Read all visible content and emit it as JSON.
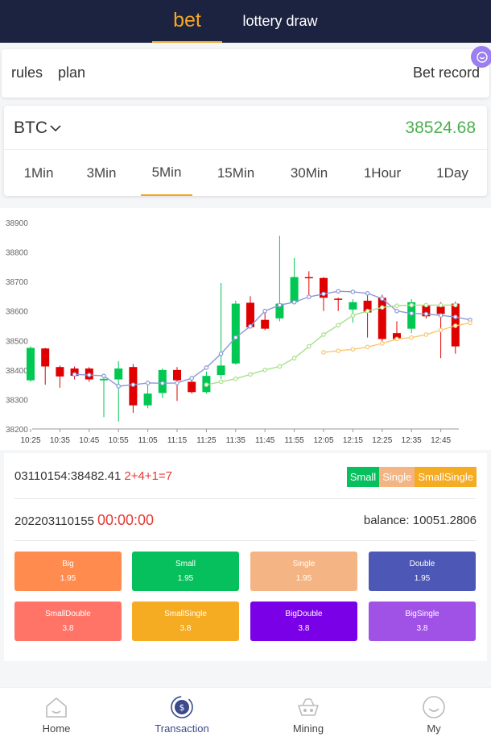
{
  "top_tabs": {
    "bet": "bet",
    "draw": "lottery draw"
  },
  "links": {
    "rules": "rules",
    "plan": "plan",
    "bet_record": "Bet record"
  },
  "market": {
    "symbol": "BTC",
    "price": "38524.68",
    "intervals": [
      "1Min",
      "3Min",
      "5Min",
      "15Min",
      "30Min",
      "1Hour",
      "1Day"
    ],
    "active_interval": "5Min"
  },
  "chart_data": {
    "type": "candlestick",
    "ylim": [
      38200,
      38900
    ],
    "yticks": [
      "38200",
      "38300",
      "38400",
      "38500",
      "38600",
      "38700",
      "38800",
      "38900"
    ],
    "xticks": [
      "10:25",
      "10:35",
      "10:45",
      "10:55",
      "11:05",
      "11:15",
      "11:25",
      "11:35",
      "11:45",
      "11:55",
      "12:05",
      "12:15",
      "12:25",
      "12:35",
      "12:45"
    ],
    "up_color": "#00c853",
    "down_color": "#e00000",
    "candles": [
      {
        "o": 38365,
        "c": 38475,
        "h": 38480,
        "l": 38360
      },
      {
        "o": 38473,
        "c": 38412,
        "h": 38475,
        "l": 38350
      },
      {
        "o": 38410,
        "c": 38378,
        "h": 38415,
        "l": 38340
      },
      {
        "o": 38405,
        "c": 38380,
        "h": 38412,
        "l": 38368
      },
      {
        "o": 38405,
        "c": 38368,
        "h": 38410,
        "l": 38360
      },
      {
        "o": 38365,
        "c": 38370,
        "h": 38380,
        "l": 38240
      },
      {
        "o": 38368,
        "c": 38405,
        "h": 38430,
        "l": 38225
      },
      {
        "o": 38410,
        "c": 38280,
        "h": 38420,
        "l": 38255
      },
      {
        "o": 38280,
        "c": 38320,
        "h": 38360,
        "l": 38270
      },
      {
        "o": 38322,
        "c": 38400,
        "h": 38405,
        "l": 38305
      },
      {
        "o": 38400,
        "c": 38365,
        "h": 38410,
        "l": 38295
      },
      {
        "o": 38360,
        "c": 38325,
        "h": 38375,
        "l": 38320
      },
      {
        "o": 38325,
        "c": 38380,
        "h": 38395,
        "l": 38320
      },
      {
        "o": 38383,
        "c": 38415,
        "h": 38695,
        "l": 38370
      },
      {
        "o": 38422,
        "c": 38625,
        "h": 38635,
        "l": 38418
      },
      {
        "o": 38628,
        "c": 38545,
        "h": 38650,
        "l": 38540
      },
      {
        "o": 38570,
        "c": 38540,
        "h": 38600,
        "l": 38535
      },
      {
        "o": 38575,
        "c": 38625,
        "h": 38855,
        "l": 38565
      },
      {
        "o": 38630,
        "c": 38715,
        "h": 38780,
        "l": 38625
      },
      {
        "o": 38715,
        "c": 38714,
        "h": 38735,
        "l": 38650
      },
      {
        "o": 38712,
        "c": 38645,
        "h": 38715,
        "l": 38600
      },
      {
        "o": 38642,
        "c": 38641,
        "h": 38645,
        "l": 38600
      },
      {
        "o": 38605,
        "c": 38630,
        "h": 38640,
        "l": 38560
      },
      {
        "o": 38635,
        "c": 38595,
        "h": 38665,
        "l": 38510
      },
      {
        "o": 38645,
        "c": 38505,
        "h": 38655,
        "l": 38495
      },
      {
        "o": 38525,
        "c": 38505,
        "h": 38565,
        "l": 38500
      },
      {
        "o": 38540,
        "c": 38630,
        "h": 38640,
        "l": 38525
      },
      {
        "o": 38618,
        "c": 38582,
        "h": 38625,
        "l": 38575
      },
      {
        "o": 38615,
        "c": 38590,
        "h": 38630,
        "l": 38440
      },
      {
        "o": 38625,
        "c": 38480,
        "h": 38632,
        "l": 38455
      }
    ],
    "ma_series": [
      {
        "color": "#8b98d8",
        "start": 3,
        "values": [
          38385,
          38383,
          38380,
          38345,
          38350,
          38356,
          38355,
          38356,
          38372,
          38408,
          38455,
          38510,
          38548,
          38600,
          38620,
          38630,
          38648,
          38658,
          38667,
          38665,
          38660,
          38642,
          38600,
          38592,
          38590,
          38585,
          38580,
          38570
        ]
      },
      {
        "color": "#a8e08a",
        "start": 12,
        "values": [
          38350,
          38360,
          38370,
          38385,
          38400,
          38412,
          38440,
          38480,
          38520,
          38552,
          38585,
          38600,
          38612,
          38618,
          38620,
          38620,
          38620,
          38620
        ]
      },
      {
        "color": "#fbc66f",
        "start": 20,
        "values": [
          38460,
          38465,
          38470,
          38478,
          38490,
          38505,
          38510,
          38520,
          38535,
          38550,
          38560
        ]
      }
    ]
  },
  "round": {
    "text": "03110154:38482.41",
    "result": "2+4+1=7",
    "tags": [
      {
        "label": "Small",
        "color": "#05c05c"
      },
      {
        "label": "Single",
        "color": "#f4b483"
      },
      {
        "label": "SmallSingle",
        "color": "#f5ab22"
      }
    ]
  },
  "period": {
    "number": "202203110155",
    "countdown": "00:00:00",
    "balance": "balance: 10051.2806"
  },
  "options": [
    {
      "name": "Big",
      "odds": "1.95",
      "color": "#ff8b4e"
    },
    {
      "name": "Small",
      "odds": "1.95",
      "color": "#05c05c"
    },
    {
      "name": "Single",
      "odds": "1.95",
      "color": "#f4b483"
    },
    {
      "name": "Double",
      "odds": "1.95",
      "color": "#4d57b5"
    },
    {
      "name": "SmallDouble",
      "odds": "3.8",
      "color": "#ff7467"
    },
    {
      "name": "SmallSingle",
      "odds": "3.8",
      "color": "#f5ab22"
    },
    {
      "name": "BigDouble",
      "odds": "3.8",
      "color": "#7a00e8"
    },
    {
      "name": "BigSingle",
      "odds": "3.8",
      "color": "#a052e6"
    }
  ],
  "nav": [
    {
      "label": "Home",
      "icon": "home-icon"
    },
    {
      "label": "Transaction",
      "icon": "coin-refresh-icon"
    },
    {
      "label": "Mining",
      "icon": "mining-cart-icon"
    },
    {
      "label": "My",
      "icon": "smiley-face-icon"
    }
  ],
  "colors": {
    "header_bg": "#1c2340",
    "accent": "#f5a623",
    "price_green": "#4caf50",
    "nav_active": "#3b4a8a"
  }
}
